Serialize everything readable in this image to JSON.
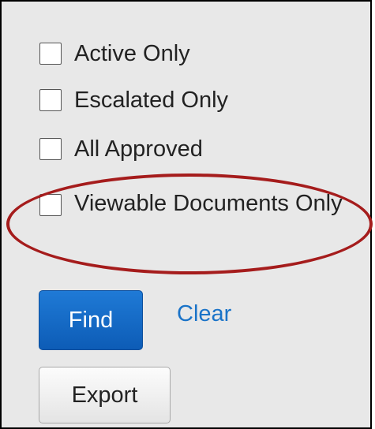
{
  "filters": {
    "active_only": {
      "label": "Active Only",
      "checked": false
    },
    "escalated_only": {
      "label": "Escalated Only",
      "checked": false
    },
    "all_approved": {
      "label": "All Approved",
      "checked": false
    },
    "viewable_documents_only": {
      "label": "Viewable Documents Only",
      "checked": false
    }
  },
  "actions": {
    "find_label": "Find",
    "clear_label": "Clear",
    "export_label": "Export"
  },
  "colors": {
    "panel_background": "#e8e8e8",
    "primary_button": "#1f7ad6",
    "link": "#1a73c8",
    "highlight_annotation": "#a51c1c"
  }
}
